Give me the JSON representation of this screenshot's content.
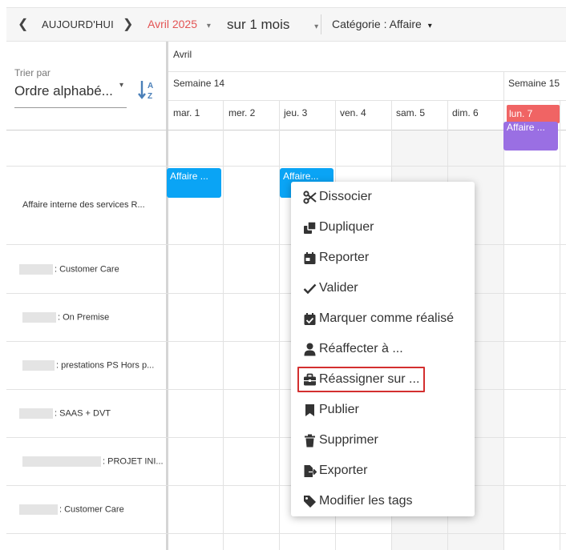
{
  "toolbar": {
    "prev": "❮",
    "today": "AUJOURD'HUI",
    "next": "❯",
    "month": "Avril 2025",
    "range": "sur 1 mois",
    "category": "Catégorie : Affaire",
    "caret": "▾",
    "accent": "#e35454"
  },
  "sorter": {
    "label": "Trier par",
    "value": "Ordre alphabé...",
    "icon": "sort-alpha-icon"
  },
  "calendar": {
    "month": "Avril",
    "weeks": [
      "Semaine 14",
      "Semaine 15"
    ],
    "days": [
      "mar. 1",
      "mer. 2",
      "jeu. 3",
      "ven. 4",
      "sam. 5",
      "dim. 6",
      "lun. 7"
    ],
    "today_color": "#f06464"
  },
  "rows": [
    "",
    "Affaire interne des services R...",
    ": Customer Care",
    ": On Premise",
    ": prestations PS Hors p...",
    ": SAAS + DVT",
    ": PROJET INI...",
    ": Customer Care"
  ],
  "events": {
    "purple": "Affaire ...",
    "blue1": "Affaire ...",
    "blue2": "Affaire..."
  },
  "context_menu": {
    "items": [
      {
        "label": "Dissocier",
        "icon": "scissors-icon"
      },
      {
        "label": "Dupliquer",
        "icon": "copy-icon"
      },
      {
        "label": "Reporter",
        "icon": "calendar-icon"
      },
      {
        "label": "Valider",
        "icon": "check-icon"
      },
      {
        "label": "Marquer comme réalisé",
        "icon": "calendar-check-icon"
      },
      {
        "label": "Réaffecter à ...",
        "icon": "user-icon"
      },
      {
        "label": "Réassigner sur ...",
        "icon": "briefcase-icon"
      },
      {
        "label": "Publier",
        "icon": "bookmark-icon"
      },
      {
        "label": "Supprimer",
        "icon": "trash-icon"
      },
      {
        "label": "Exporter",
        "icon": "file-export-icon"
      },
      {
        "label": "Modifier les tags",
        "icon": "tag-icon"
      }
    ],
    "highlight_color": "#d32f2f"
  }
}
